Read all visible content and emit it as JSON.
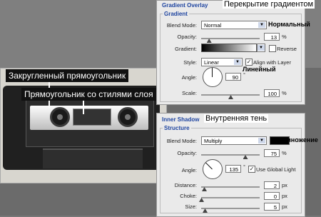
{
  "captions": {
    "gradient_overlay_ru": "Перекрытие градиентом",
    "normal_ru": "Нормальный",
    "linear_ru": "Линейный",
    "inner_shadow_ru": "Внутренняя тень",
    "multiply_ru": "Умножение",
    "rounded_rect_ru": "Закругленный прямоугольник",
    "styled_rect_ru": "Прямоугольник со стилями слоя"
  },
  "panel1": {
    "title": "Gradient Overlay",
    "section": "Gradient",
    "blend_mode_label": "Blend Mode:",
    "blend_mode_value": "Normal",
    "opacity_label": "Opacity:",
    "opacity_value": "13",
    "opacity_level": 0.13,
    "opacity_unit": "%",
    "gradient_label": "Gradient:",
    "reverse_label": "Reverse",
    "style_label": "Style:",
    "style_value": "Linear",
    "align_label": "Align with Layer",
    "angle_label": "Angle:",
    "angle_value": "90",
    "angle_unit": "°",
    "scale_label": "Scale:",
    "scale_value": "100",
    "scale_level": 0.5,
    "scale_unit": "%"
  },
  "panel2": {
    "title": "Inner Shadow",
    "section": "Structure",
    "blend_mode_label": "Blend Mode:",
    "blend_mode_value": "Multiply",
    "opacity_label": "Opacity:",
    "opacity_value": "75",
    "opacity_level": 0.75,
    "opacity_unit": "%",
    "angle_label": "Angle:",
    "angle_value": "135",
    "angle_unit": "°",
    "global_light_label": "Use Global Light",
    "distance_label": "Distance:",
    "distance_value": "2",
    "choke_label": "Choke:",
    "choke_value": "0",
    "size_label": "Size:",
    "size_value": "5",
    "px_unit": "px",
    "shadow_color": "#000000"
  }
}
